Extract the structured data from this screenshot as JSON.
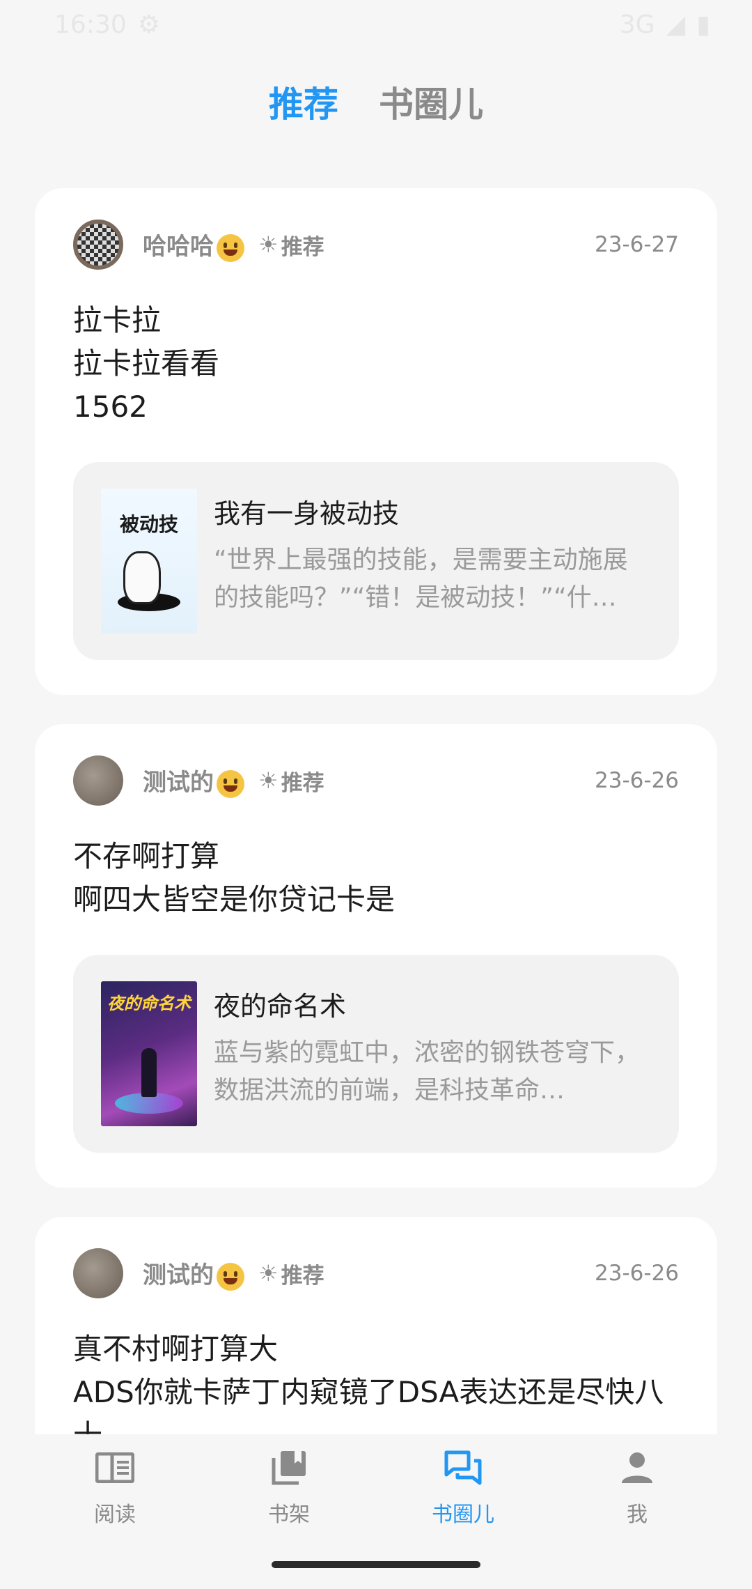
{
  "status_bar": {
    "time": "16:30",
    "network": "3G"
  },
  "top_tabs": [
    {
      "label": "推荐",
      "active": true
    },
    {
      "label": "书圈儿",
      "active": false
    }
  ],
  "posts": [
    {
      "username": "哈哈哈",
      "recommend_label": "推荐",
      "date": "23-6-27",
      "lines": [
        "拉卡拉",
        "拉卡拉看看",
        "1562"
      ],
      "book": {
        "title": "我有一身被动技",
        "cover_text": "被动技",
        "description": "“世界上最强的技能，是需要主动施展的技能吗？”“错！是被动技！”“什…"
      }
    },
    {
      "username": "测试的",
      "recommend_label": "推荐",
      "date": "23-6-26",
      "lines": [
        "不存啊打算",
        "啊四大皆空是你贷记卡是"
      ],
      "book": {
        "title": "夜的命名术",
        "cover_text": "夜的命名术",
        "description": "蓝与紫的霓虹中，浓密的钢铁苍穹下，数据洪流的前端，是科技革命…"
      }
    },
    {
      "username": "测试的",
      "recommend_label": "推荐",
      "date": "23-6-26",
      "lines": [
        "真不村啊打算大",
        "ADS你就卡萨丁内窥镜了DSA表达还是尽快八十"
      ]
    }
  ],
  "bottom_nav": [
    {
      "label": "阅读",
      "icon": "book-open-icon",
      "active": false
    },
    {
      "label": "书架",
      "icon": "bookshelf-icon",
      "active": false
    },
    {
      "label": "书圈儿",
      "icon": "chat-bubbles-icon",
      "active": true
    },
    {
      "label": "我",
      "icon": "person-icon",
      "active": false
    }
  ],
  "colors": {
    "accent": "#2196f3",
    "muted": "#8a8a8a",
    "background": "#f6f6f6",
    "card": "#ffffff"
  }
}
